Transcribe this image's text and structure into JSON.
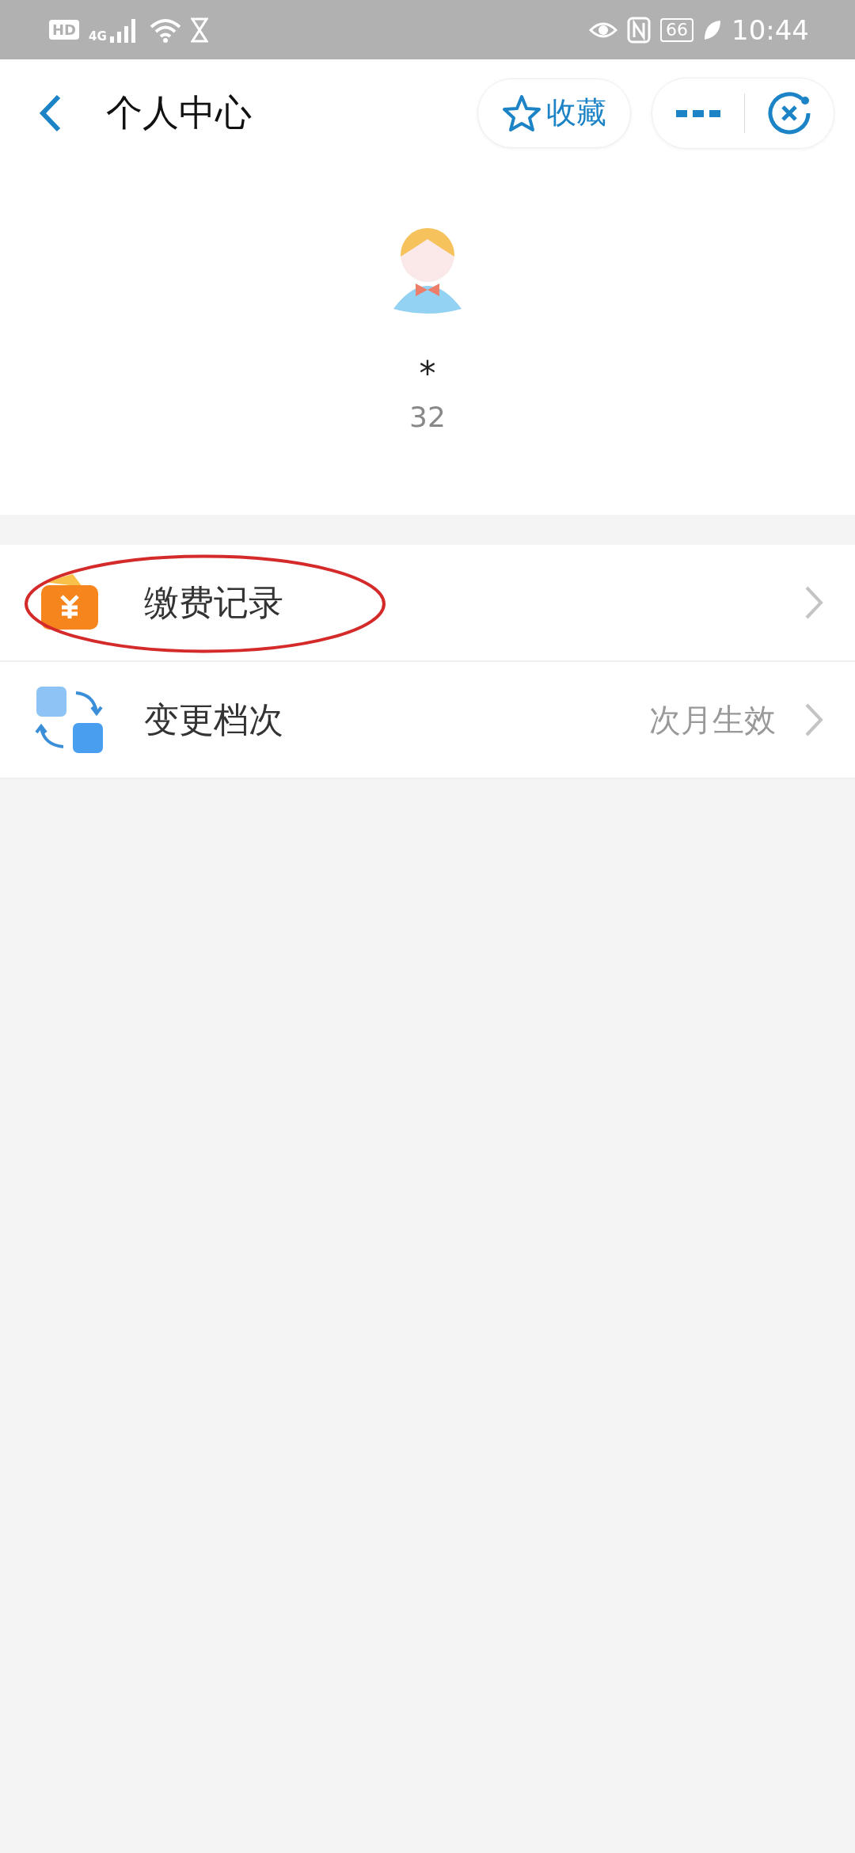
{
  "status_bar": {
    "hd": "HD",
    "network": "4G",
    "battery": "66",
    "time": "10:44"
  },
  "header": {
    "title": "个人中心",
    "favorite": "收藏"
  },
  "profile": {
    "name": "*",
    "id": "32"
  },
  "menu": [
    {
      "kind": "payment",
      "label": "缴费记录",
      "circled": true
    },
    {
      "kind": "change",
      "label": "变更档次",
      "value": "次月生效",
      "circled": false
    }
  ]
}
